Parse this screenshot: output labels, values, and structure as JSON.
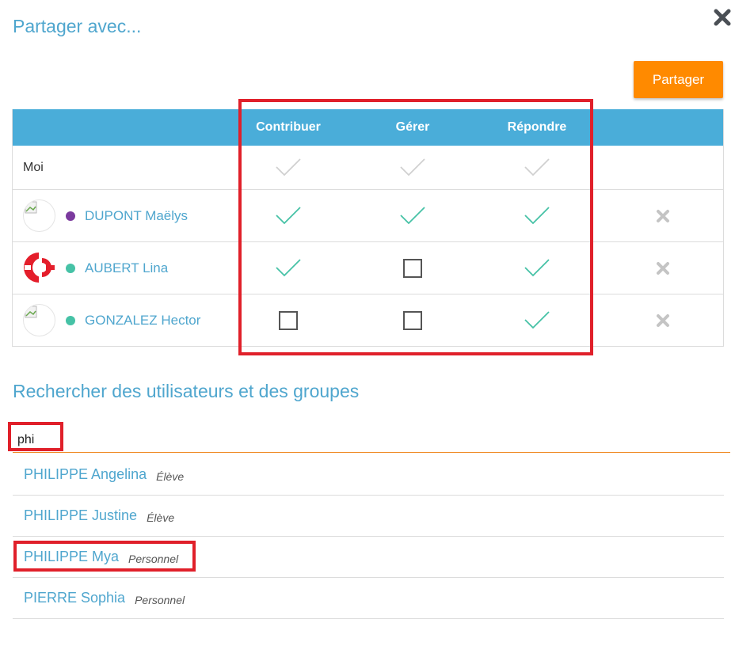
{
  "dialog": {
    "title": "Partager avec...",
    "share_button": "Partager"
  },
  "table": {
    "columns": [
      "Contribuer",
      "Gérer",
      "Répondre"
    ],
    "me_label": "Moi",
    "rows": [
      {
        "name": "DUPONT Maëlys",
        "status_color": "#7b3a9e",
        "avatar": "broken-image",
        "contribuer": true,
        "gerer": true,
        "repondre": true
      },
      {
        "name": "AUBERT Lina",
        "status_color": "#46c2a6",
        "avatar": "red-white-logo",
        "contribuer": true,
        "gerer": false,
        "repondre": true
      },
      {
        "name": "GONZALEZ Hector",
        "status_color": "#46c2a6",
        "avatar": "broken-image",
        "contribuer": false,
        "gerer": false,
        "repondre": true
      }
    ]
  },
  "search": {
    "title": "Rechercher des utilisateurs et des groupes",
    "value": "phi"
  },
  "results": [
    {
      "name": "PHILIPPE Angelina",
      "type": "Élève"
    },
    {
      "name": "PHILIPPE Justine",
      "type": "Élève"
    },
    {
      "name": "PHILIPPE Mya",
      "type": "Personnel"
    },
    {
      "name": "PIERRE Sophia",
      "type": "Personnel"
    }
  ],
  "colors": {
    "accent": "#4fa6ce",
    "header": "#4aadd9",
    "button": "#ff8a00",
    "check": "#46c2a6",
    "check_disabled": "#d0d0d0",
    "highlight": "#e0202a"
  }
}
